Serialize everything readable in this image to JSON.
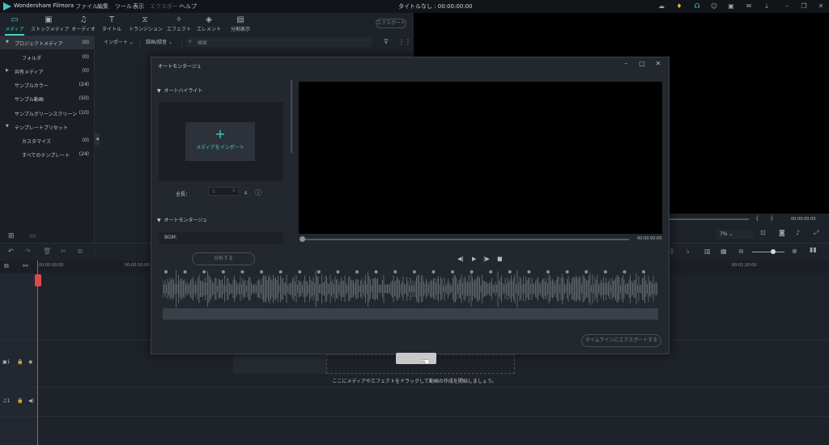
{
  "app": {
    "name": "Wondershare Filmora",
    "menus": [
      "ファイル",
      "編集",
      "ツール",
      "表示",
      "エクスポート",
      "ヘルプ"
    ],
    "project_title": "タイトルなし : 00:00:00:00"
  },
  "toolbar": {
    "tabs": [
      {
        "label": "メディア",
        "icon": "folder-icon"
      },
      {
        "label": "ストックメディア",
        "icon": "stock-media-icon"
      },
      {
        "label": "オーディオ",
        "icon": "music-note-icon"
      },
      {
        "label": "タイトル",
        "icon": "text-icon"
      },
      {
        "label": "トランジション",
        "icon": "transition-icon"
      },
      {
        "label": "エフェクト",
        "icon": "effects-icon"
      },
      {
        "label": "エレメント",
        "icon": "elements-icon"
      },
      {
        "label": "分割表示",
        "icon": "split-screen-icon"
      }
    ],
    "active_tab": "メディア",
    "export_label": "エクスポート"
  },
  "sidebar": {
    "items": [
      {
        "label": "プロジェクトメディア",
        "count": "(0)",
        "level": 0,
        "expandable": true
      },
      {
        "label": "フォルダ",
        "count": "(0)",
        "level": 1
      },
      {
        "label": "共有メディア",
        "count": "(0)",
        "level": 0,
        "expandable": true
      },
      {
        "label": "サンプルカラー",
        "count": "(24)",
        "level": 0
      },
      {
        "label": "サンプル動画",
        "count": "(50)",
        "level": 0
      },
      {
        "label": "サンプルグリーンスクリーン",
        "count": "(10)",
        "level": 0
      },
      {
        "label": "テンプレートプリセット",
        "count": "",
        "level": 0,
        "expandable": true
      },
      {
        "label": "カスタマイズ",
        "count": "(0)",
        "level": 1
      },
      {
        "label": "すべてのテンプレート",
        "count": "(24)",
        "level": 1
      }
    ]
  },
  "media": {
    "import_label": "インポート",
    "record_label": "録画/録音",
    "search_placeholder": "検索"
  },
  "preview": {
    "timecode": "00:00:00:00",
    "zoom": "7%"
  },
  "timeline": {
    "ruler_labels": [
      "00:00:00:00",
      "00:00:10:00",
      "00:01:20:00"
    ],
    "drop_hint": "ここにメディアやエフェクトをドラッグして動画の作成を開始しましょう。"
  },
  "modal": {
    "title": "オートモンタージュ",
    "section_highlight": "オートハイライト",
    "import_label": "メディアをインポート",
    "length_label": "全長：",
    "length_value": "1",
    "length_unit": "s",
    "section_montage": "オートモンタージュ",
    "bgm_label": "BGM:",
    "analyze_label": "分析する",
    "timecode": "00:00:00:00",
    "export_timeline_label": "タイムラインにエクスポートする"
  }
}
